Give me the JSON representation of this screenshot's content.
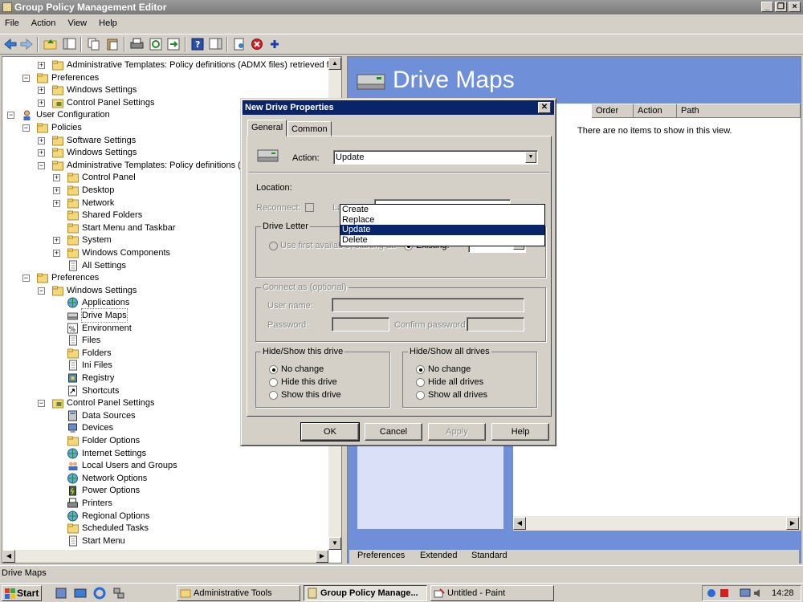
{
  "window": {
    "title": "Group Policy Management Editor"
  },
  "menu": [
    "File",
    "Action",
    "View",
    "Help"
  ],
  "tree": [
    {
      "indent": 3,
      "exp": "+",
      "icon": "folder",
      "label": "Administrative Templates: Policy definitions (ADMX files) retrieved from"
    },
    {
      "indent": 2,
      "exp": "-",
      "icon": "folder",
      "label": "Preferences"
    },
    {
      "indent": 3,
      "exp": "+",
      "icon": "folder",
      "label": "Windows Settings"
    },
    {
      "indent": 3,
      "exp": "+",
      "icon": "cpfolder",
      "label": "Control Panel Settings"
    },
    {
      "indent": 1,
      "exp": "-",
      "icon": "user",
      "label": "User Configuration"
    },
    {
      "indent": 2,
      "exp": "-",
      "icon": "folder",
      "label": "Policies"
    },
    {
      "indent": 3,
      "exp": "+",
      "icon": "folder",
      "label": "Software Settings"
    },
    {
      "indent": 3,
      "exp": "+",
      "icon": "folder",
      "label": "Windows Settings"
    },
    {
      "indent": 3,
      "exp": "-",
      "icon": "folder",
      "label": "Administrative Templates: Policy definitions (AD"
    },
    {
      "indent": 4,
      "exp": "+",
      "icon": "folder",
      "label": "Control Panel"
    },
    {
      "indent": 4,
      "exp": "+",
      "icon": "folder",
      "label": "Desktop"
    },
    {
      "indent": 4,
      "exp": "+",
      "icon": "folder",
      "label": "Network"
    },
    {
      "indent": 4,
      "exp": "",
      "icon": "folder",
      "label": "Shared Folders"
    },
    {
      "indent": 4,
      "exp": "",
      "icon": "folder",
      "label": "Start Menu and Taskbar"
    },
    {
      "indent": 4,
      "exp": "+",
      "icon": "folder",
      "label": "System"
    },
    {
      "indent": 4,
      "exp": "+",
      "icon": "folder",
      "label": "Windows Components"
    },
    {
      "indent": 4,
      "exp": "",
      "icon": "doc",
      "label": "All Settings"
    },
    {
      "indent": 2,
      "exp": "-",
      "icon": "folder",
      "label": "Preferences"
    },
    {
      "indent": 3,
      "exp": "-",
      "icon": "folder",
      "label": "Windows Settings"
    },
    {
      "indent": 4,
      "exp": "",
      "icon": "globe",
      "label": "Applications"
    },
    {
      "indent": 4,
      "exp": "",
      "icon": "drive",
      "label": "Drive Maps"
    },
    {
      "indent": 4,
      "exp": "",
      "icon": "env",
      "label": "Environment"
    },
    {
      "indent": 4,
      "exp": "",
      "icon": "doc",
      "label": "Files"
    },
    {
      "indent": 4,
      "exp": "",
      "icon": "folder",
      "label": "Folders"
    },
    {
      "indent": 4,
      "exp": "",
      "icon": "doc",
      "label": "Ini Files"
    },
    {
      "indent": 4,
      "exp": "",
      "icon": "reg",
      "label": "Registry"
    },
    {
      "indent": 4,
      "exp": "",
      "icon": "shortcut",
      "label": "Shortcuts"
    },
    {
      "indent": 3,
      "exp": "-",
      "icon": "cpfolder",
      "label": "Control Panel Settings"
    },
    {
      "indent": 4,
      "exp": "",
      "icon": "datasrc",
      "label": "Data Sources"
    },
    {
      "indent": 4,
      "exp": "",
      "icon": "devices",
      "label": "Devices"
    },
    {
      "indent": 4,
      "exp": "",
      "icon": "folder",
      "label": "Folder Options"
    },
    {
      "indent": 4,
      "exp": "",
      "icon": "globe",
      "label": "Internet Settings"
    },
    {
      "indent": 4,
      "exp": "",
      "icon": "users",
      "label": "Local Users and Groups"
    },
    {
      "indent": 4,
      "exp": "",
      "icon": "globe",
      "label": "Network Options"
    },
    {
      "indent": 4,
      "exp": "",
      "icon": "power",
      "label": "Power Options"
    },
    {
      "indent": 4,
      "exp": "",
      "icon": "printer",
      "label": "Printers"
    },
    {
      "indent": 4,
      "exp": "",
      "icon": "globe",
      "label": "Regional Options"
    },
    {
      "indent": 4,
      "exp": "",
      "icon": "folder",
      "label": "Scheduled Tasks"
    },
    {
      "indent": 4,
      "exp": "",
      "icon": "doc",
      "label": "Start Menu"
    }
  ],
  "right": {
    "heading": "Drive Maps",
    "columns": [
      "Order",
      "Action",
      "Path"
    ],
    "empty_text": "There are no items to show in this view.",
    "tabs": [
      "Preferences",
      "Extended",
      "Standard"
    ]
  },
  "dialog": {
    "title": "New Drive Properties",
    "close": "✕",
    "tabs": [
      "General",
      "Common"
    ],
    "action_label": "Action:",
    "action_value": "Update",
    "action_options": [
      "Create",
      "Replace",
      "Update",
      "Delete"
    ],
    "location_label": "Location:",
    "reconnect_label": "Reconnect:",
    "label_as_label": "Label as:",
    "drive_letter": {
      "title": "Drive Letter",
      "first_available": "Use first available, starting at:",
      "existing": "Existing:"
    },
    "connect_as": {
      "title": "Connect as (optional)",
      "user": "User name:",
      "password": "Password:",
      "confirm": "Confirm password:"
    },
    "hide_this": {
      "title": "Hide/Show this drive",
      "options": [
        "No change",
        "Hide this drive",
        "Show this drive"
      ]
    },
    "hide_all": {
      "title": "Hide/Show all drives",
      "options": [
        "No change",
        "Hide all drives",
        "Show all drives"
      ]
    },
    "buttons": {
      "ok": "OK",
      "cancel": "Cancel",
      "apply": "Apply",
      "help": "Help"
    }
  },
  "status": "Drive Maps",
  "taskbar": {
    "start": "Start",
    "items": [
      "Administrative Tools",
      "Group Policy Manage...",
      "Untitled - Paint"
    ],
    "time": "14:28"
  },
  "colors": {
    "selection": "#0a246a",
    "taskpane": "#6f8fd9"
  }
}
